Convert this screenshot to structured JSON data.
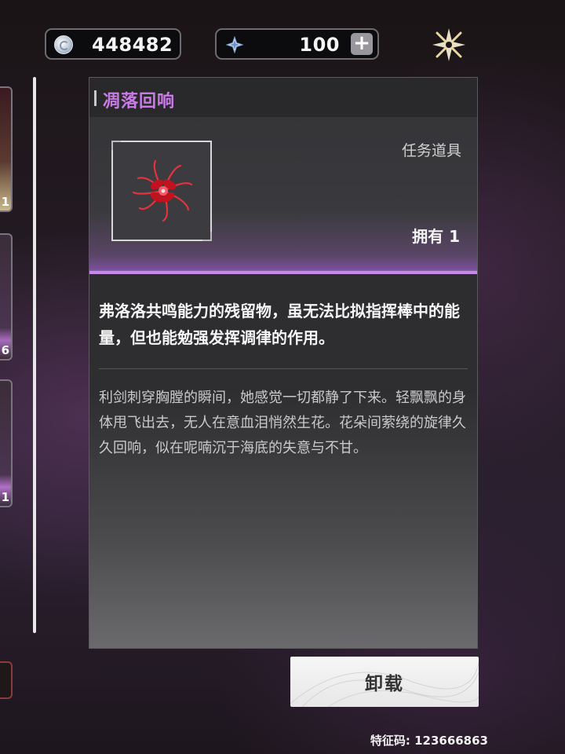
{
  "currencies": {
    "coins": {
      "icon": "coin-icon",
      "value": "448482"
    },
    "stars": {
      "icon": "star-crystal-icon",
      "value": "100",
      "add_label": "+"
    }
  },
  "sidebar": {
    "cards": [
      {
        "count": "1"
      },
      {
        "count": "6"
      },
      {
        "count": "1"
      }
    ]
  },
  "item": {
    "name": "凋落回响",
    "type": "任务道具",
    "owned": "拥有 1",
    "description": "弗洛洛共鸣能力的残留物，虽无法比拟指挥棒中的能量，但也能勉强发挥调律的作用。",
    "flavor": "利剑刺穿胸膛的瞬间，她感觉一切都静了下来。轻飘飘的身体甩飞出去，无人在意血泪悄然生花。花朵间萦绕的旋律久久回响，似在呢喃沉于海底的失意与不甘。"
  },
  "actions": {
    "unload_label": "卸载"
  },
  "footer": {
    "code": "特征码: 123666863"
  },
  "colors": {
    "title": "#c97be6",
    "accent": "#b77be0"
  }
}
